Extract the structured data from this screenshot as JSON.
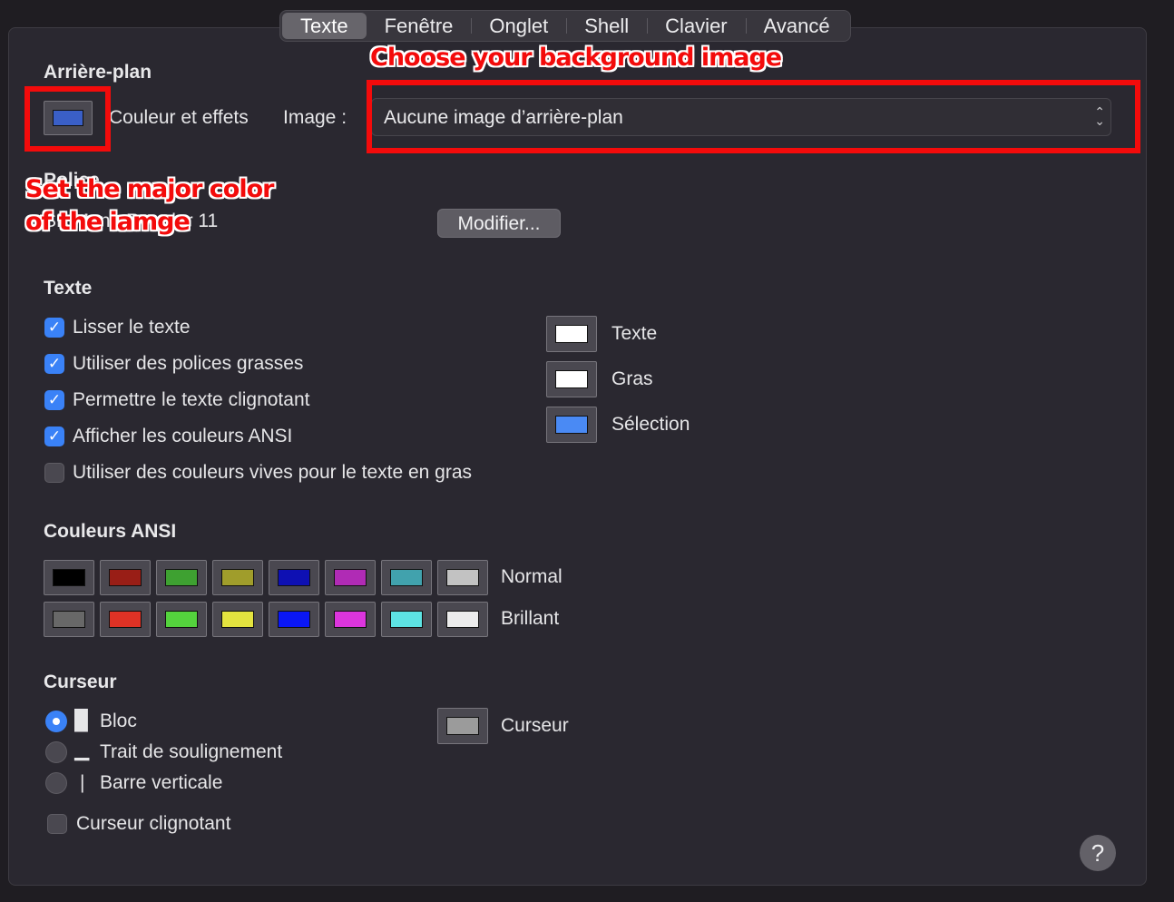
{
  "tabs": [
    "Texte",
    "Fenêtre",
    "Onglet",
    "Shell",
    "Clavier",
    "Avancé"
  ],
  "background": {
    "title": "Arrière-plan",
    "color_effects_label": "Couleur et effets",
    "image_label": "Image :",
    "image_select_value": "Aucune image d’arrière-plan",
    "swatch_color": "#3a5fc7"
  },
  "font": {
    "title": "Police",
    "value": "SF Mono Regular 11",
    "modify_button": "Modifier..."
  },
  "text_section": {
    "title": "Texte",
    "checkboxes": [
      {
        "label": "Lisser le texte",
        "checked": true
      },
      {
        "label": "Utiliser des polices grasses",
        "checked": true
      },
      {
        "label": "Permettre le texte clignotant",
        "checked": true
      },
      {
        "label": "Afficher les couleurs ANSI",
        "checked": true
      },
      {
        "label": "Utiliser des couleurs vives pour le texte en gras",
        "checked": false
      }
    ],
    "colors": [
      {
        "label": "Texte",
        "color": "#ffffff"
      },
      {
        "label": "Gras",
        "color": "#ffffff"
      },
      {
        "label": "Sélection",
        "color": "#4a8af4"
      }
    ]
  },
  "ansi": {
    "title": "Couleurs ANSI",
    "normal_label": "Normal",
    "bright_label": "Brillant",
    "normal": [
      "#000000",
      "#991e16",
      "#3ea131",
      "#a09d2b",
      "#0e10b3",
      "#b02bb5",
      "#41a2ad",
      "#c2c2c2"
    ],
    "bright": [
      "#686868",
      "#df3225",
      "#54d33d",
      "#e3e33f",
      "#0a17f5",
      "#dc35dd",
      "#5de3e3",
      "#ebebeb"
    ]
  },
  "cursor": {
    "title": "Curseur",
    "options": [
      {
        "glyph": "█",
        "label": "Bloc",
        "selected": true
      },
      {
        "glyph": "▁",
        "label": "Trait de soulignement",
        "selected": false
      },
      {
        "glyph": "|",
        "label": "Barre verticale",
        "selected": false
      }
    ],
    "blink_label": "Curseur clignotant",
    "blink_checked": false,
    "color_label": "Curseur",
    "color": "#9b9b9b"
  },
  "annotations": {
    "image_note": "Choose your background image",
    "color_note_line1": "Set the major color",
    "color_note_line2": "of the iamge",
    "color": "#f30b0b"
  },
  "help_label": "?"
}
